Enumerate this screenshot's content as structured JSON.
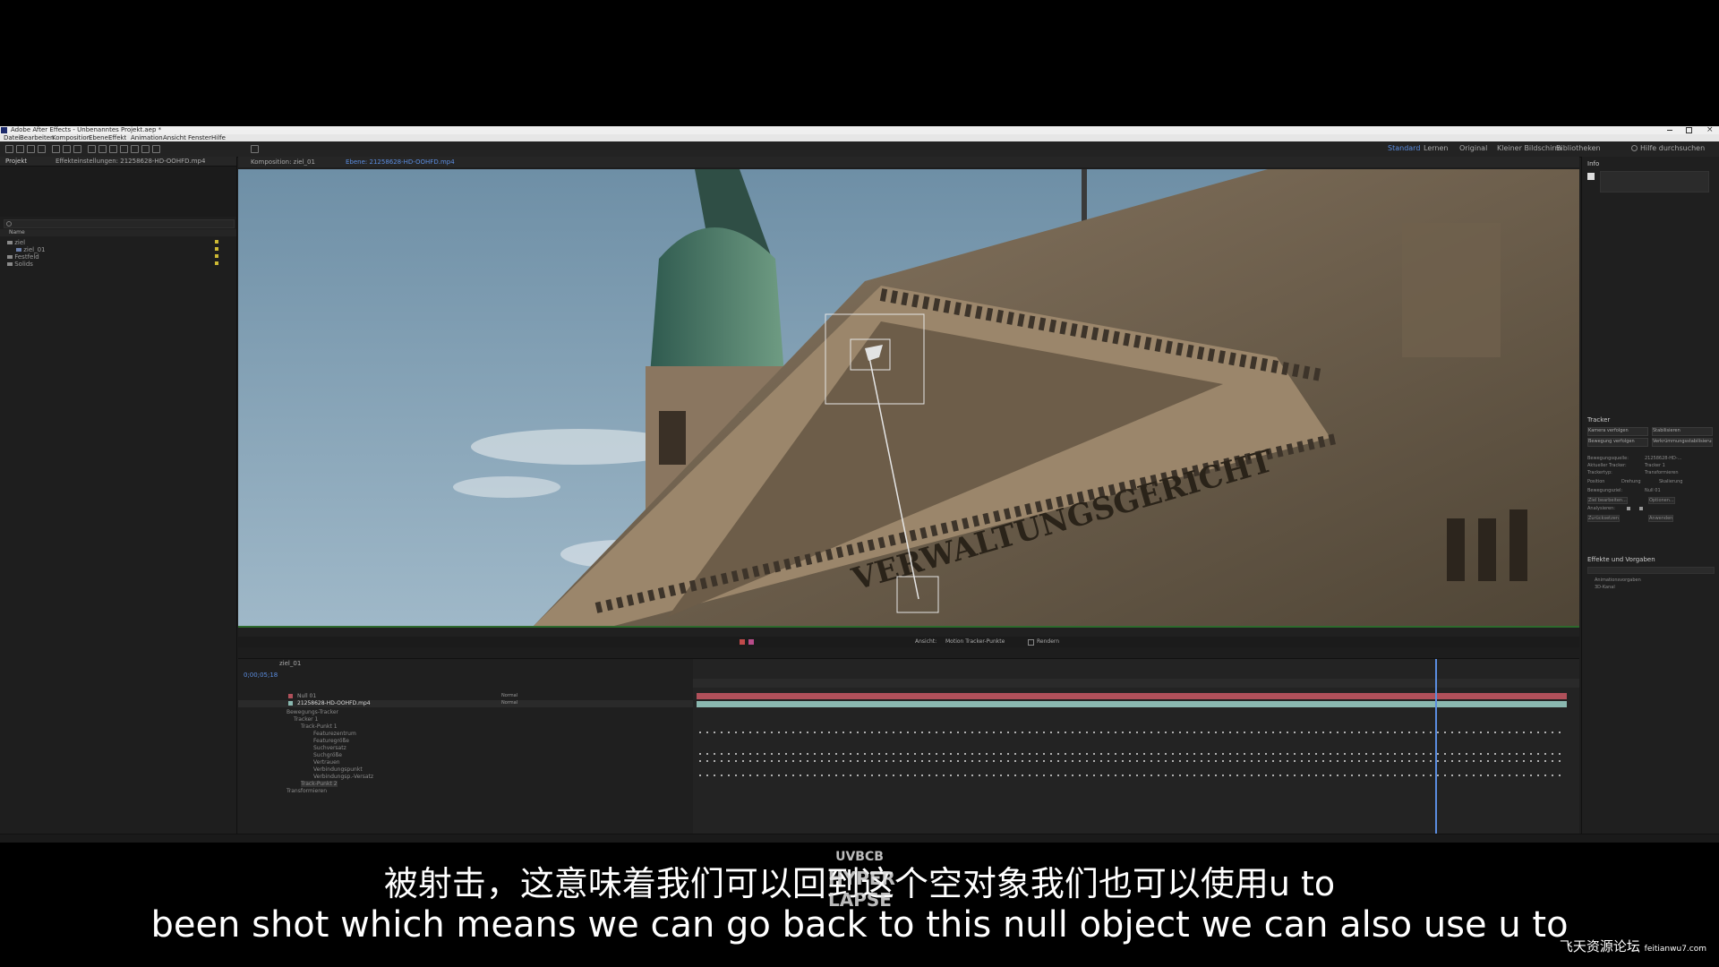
{
  "app": {
    "title": "Adobe After Effects - Unbenanntes Projekt.aep *",
    "menus": [
      "Datei",
      "Bearbeiten",
      "Komposition",
      "Ebene",
      "Effekt",
      "Animation",
      "Ansicht",
      "Fenster",
      "Hilfe"
    ],
    "workspaces": [
      "Standard",
      "Lernen",
      "Original",
      "Kleiner Bildschirm",
      "Bibliotheken"
    ],
    "help_search": "Hilfe durchsuchen"
  },
  "project_panel": {
    "tab_label": "Projekt",
    "footage_label": "Effekteinstellungen: 21258628-HD-OOHFD.mp4",
    "column_name": "Name",
    "items": [
      "ziel",
      "ziel_01",
      "Festfeld",
      "Solids"
    ]
  },
  "composition": {
    "tabs": [
      "Komposition: ziel_01",
      "Ebene: 21258628-HD-OOHFD.mp4"
    ],
    "scene_text": "VERWALTUNGSGERICHT",
    "bottom_labels": [
      "Ansicht:",
      "Motion Tracker-Punkte",
      "Rendern"
    ]
  },
  "right_panel": {
    "info_label": "Info",
    "tracker_label": "Tracker",
    "buttons": [
      "Kamera verfolgen",
      "Stabilisieren",
      "Bewegung verfolgen",
      "Verkrümmungsstabilisierung"
    ],
    "source_label": "Bewegungsquelle:",
    "source_value": "21258628-HD-...",
    "track_label": "Aktueller Tracker:",
    "track_value": "Tracker 1",
    "type_label": "Trackertyp:",
    "type_value": "Transformieren",
    "option_labels": [
      "Position",
      "Drehung",
      "Skalierung"
    ],
    "target_label": "Bewegungsziel:",
    "target_value": "Null 01",
    "edit_target": "Ziel bearbeiten...",
    "options": "Optionen...",
    "analyze_label": "Analysieren:",
    "reset": "Zurücksetzen",
    "apply": "Anwenden",
    "effects_label": "Effekte und Vorgaben",
    "effects_items": [
      "Animationsvorgaben",
      "3D-Kanal"
    ]
  },
  "timeline": {
    "tab_label": "ziel_01",
    "timecode": "0;00;05;18",
    "layers": [
      "Null 01",
      "21258628-HD-OOHFD.mp4"
    ],
    "props": [
      "Bewegungs-Tracker",
      "Tracker 1",
      "Track-Punkt 1",
      "Featurezentrum",
      "Featuregröße",
      "Suchversatz",
      "Suchgröße",
      "Vertrauen",
      "Verbindungspunkt",
      "Verbindungsp.-Versatz",
      "Track-Punkt 2",
      "Transformieren"
    ],
    "mode_value": "Normal"
  },
  "subtitles": {
    "chinese": "被射击，这意味着我们可以回到这个空对象我们也可以使用u to",
    "english": "been shot which means we can go back to this null object we can also use u to"
  },
  "watermarks": {
    "center": [
      "UVBCB",
      "HYPER",
      "LAPSE"
    ],
    "corner": "飞天资源论坛",
    "corner_url": "feitianwu7.com"
  },
  "colors": {
    "accent": "#5b8de0",
    "track_green": "#2d6a2d",
    "layer_red": "#b0505a",
    "layer_teal": "#8ab8b0"
  }
}
